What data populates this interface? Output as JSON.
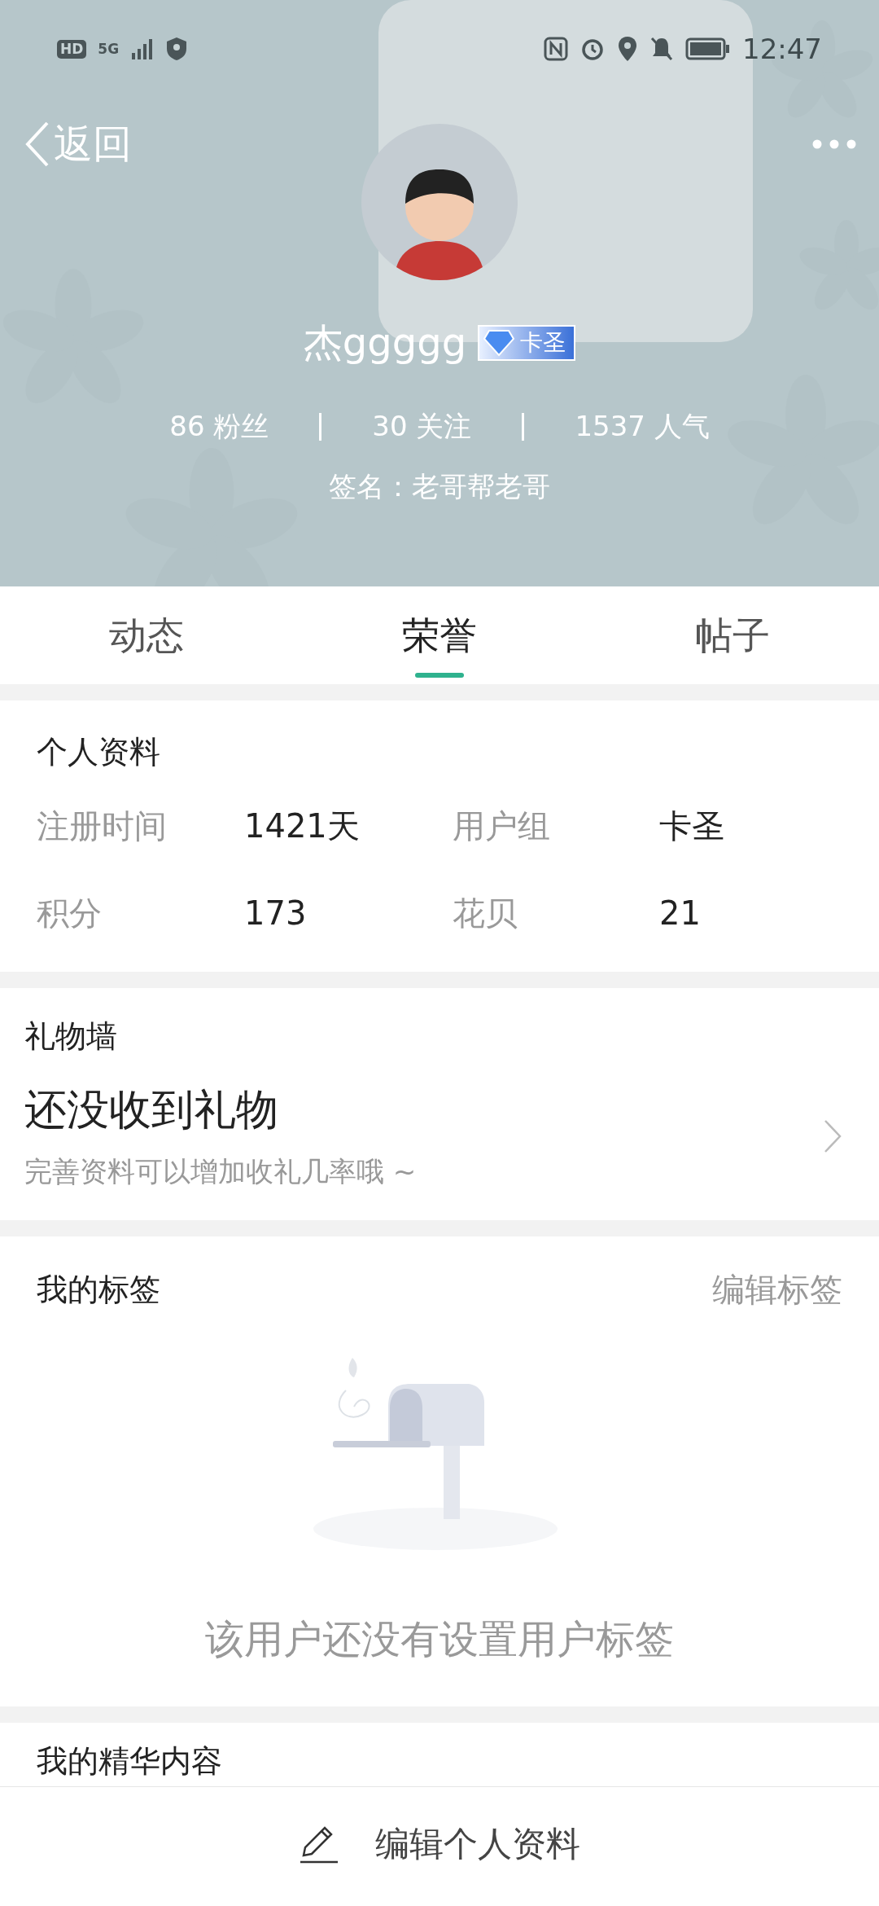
{
  "status_bar": {
    "left_badges": [
      "HD",
      "5G"
    ],
    "time": "12:47"
  },
  "header": {
    "back_label": "返回",
    "username": "杰ggggg",
    "rank_badge": "卡圣",
    "stats": [
      "86 粉丝",
      "30 关注",
      "1537 人气"
    ],
    "signature": "签名：老哥帮老哥"
  },
  "tabs": [
    {
      "label": "动态",
      "selected": false
    },
    {
      "label": "荣誉",
      "selected": true
    },
    {
      "label": "帖子",
      "selected": false
    }
  ],
  "profile": {
    "title": "个人资料",
    "fields": [
      {
        "label": "注册时间",
        "value": "1421天"
      },
      {
        "label": "用户组",
        "value": "卡圣"
      },
      {
        "label": "积分",
        "value": "173"
      },
      {
        "label": "花贝",
        "value": "21"
      }
    ]
  },
  "gift_wall": {
    "title": "礼物墙",
    "headline": "还没收到礼物",
    "hint": "完善资料可以增加收礼几率哦 ~"
  },
  "tags": {
    "title": "我的标签",
    "action": "编辑标签",
    "empty_text": "该用户还没有设置用户标签"
  },
  "featured": {
    "title": "我的精华内容"
  },
  "bottom_bar": {
    "button": "编辑个人资料"
  }
}
